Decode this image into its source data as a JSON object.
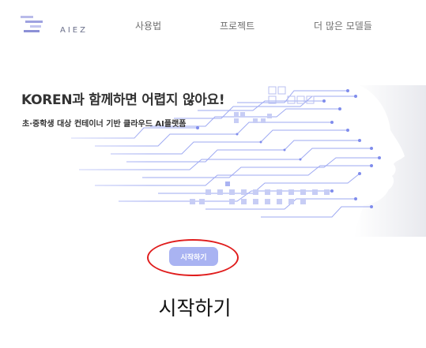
{
  "header": {
    "logo_text": "AIEZ",
    "nav": [
      {
        "label": "사용법"
      },
      {
        "label": "프로젝트"
      },
      {
        "label": "더 많은 모델들"
      }
    ]
  },
  "hero": {
    "title": "KOREN과 함께하면 어렵지 않아요!",
    "subtitle": "초·중학생 대상 컨테이너 기반 클라우드 AI플랫폼",
    "start_button": "시작하기"
  },
  "annotation": {
    "caption": "시작하기",
    "ring_color": "#e01d1d"
  },
  "colors": {
    "accent": "#a9b3f2",
    "circuit": "#8e9bf0",
    "text": "#333333"
  }
}
